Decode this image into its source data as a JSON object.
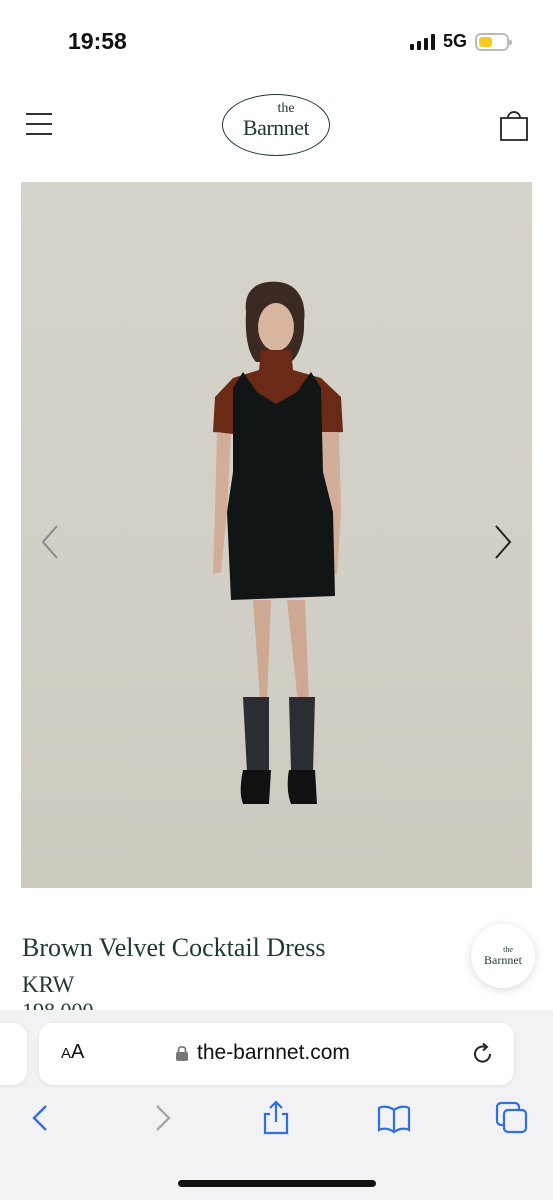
{
  "status_bar": {
    "time": "19:58",
    "network": "5G",
    "battery_level": 0.5,
    "battery_color": "#f4cb1c"
  },
  "header": {
    "logo_small": "the",
    "logo_name": "Barnnet",
    "menu_icon": "hamburger-menu-icon",
    "cart_icon": "shopping-bag-icon"
  },
  "product": {
    "title": "Brown Velvet Cocktail Dress",
    "currency": "KRW",
    "price": "198,000",
    "image_alt": "model wearing black velvet dress over brown top",
    "prev_icon": "chevron-left-icon",
    "next_icon": "chevron-right-icon"
  },
  "chat_badge": {
    "small": "the",
    "name": "Barnnet"
  },
  "browser": {
    "text_size_label_small": "A",
    "text_size_label_big": "A",
    "url": "the-barnnet.com",
    "lock_icon": "lock-icon",
    "reload_icon": "reload-icon",
    "toolbar": [
      "back-icon",
      "forward-icon",
      "share-icon",
      "bookmarks-icon",
      "tabs-icon"
    ]
  },
  "colors": {
    "brand_green": "#1e3a2a",
    "ios_blue": "#2f6fe0"
  }
}
